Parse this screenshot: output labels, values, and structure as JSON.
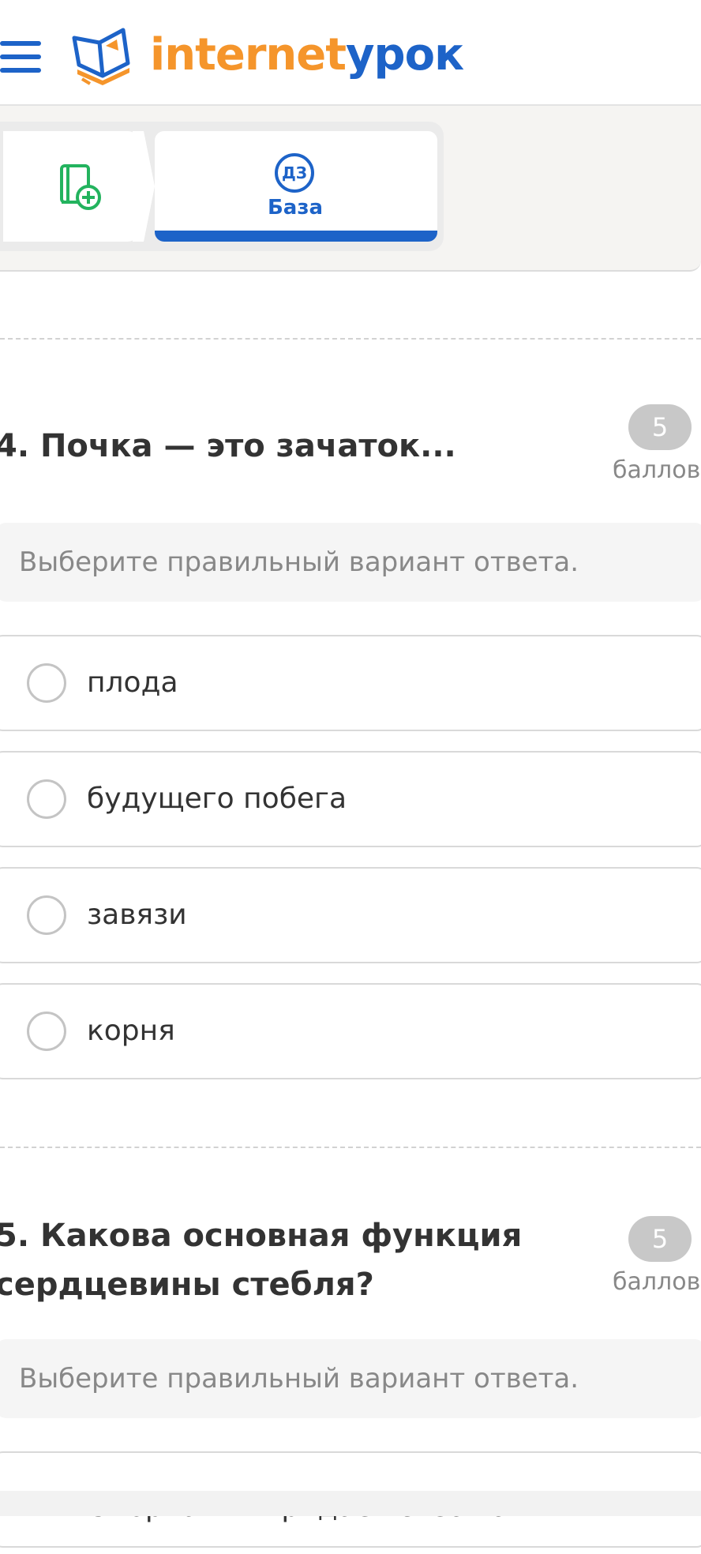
{
  "header": {
    "logo_part1": "internet",
    "logo_part2": "урок",
    "brand_orange": "#f5952b",
    "brand_blue": "#1d63c8"
  },
  "tabs": {
    "first_icon": "book-plus-icon",
    "second_badge": "ДЗ",
    "second_label": "База"
  },
  "questions": [
    {
      "title": "4. Почка — это зачаток...",
      "points": "5",
      "points_label": "баллов",
      "hint": "Выберите правильный вариант ответа.",
      "options": [
        "плода",
        "будущего побега",
        "завязи",
        "корня"
      ]
    },
    {
      "title_line1": "5. Какова основная функция",
      "title_line2": "сердцевины стебля?",
      "points": "5",
      "points_label": "баллов",
      "hint": "Выберите правильный вариант ответа.",
      "options": [
        "Опорная — придаёт стеблю"
      ]
    }
  ]
}
